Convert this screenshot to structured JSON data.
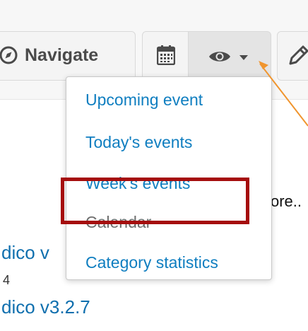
{
  "toolbar": {
    "navigate_label": "Navigate",
    "navigate_icon": "compass-icon",
    "calendar_icon": "calendar-icon",
    "view_icon": "eye-icon",
    "view_caret_icon": "caret-down-icon",
    "edit_icon": "pencil-icon"
  },
  "dropdown": {
    "items": [
      {
        "label": "Upcoming event",
        "enabled": true
      },
      {
        "label": "Today's events",
        "enabled": true
      },
      {
        "label": "Week's events",
        "enabled": true
      },
      {
        "label": "Calendar",
        "enabled": false
      },
      {
        "label": "Category statistics",
        "enabled": true
      }
    ]
  },
  "background": {
    "more_text": "ore..",
    "event1_title": "dico v",
    "event1_sub": "4",
    "event2_title": "dico v3.2.7"
  },
  "colors": {
    "link": "#0f7ec0",
    "disabled": "#6e6e6e",
    "highlight": "#a50d0d",
    "arrow": "#f0952e"
  }
}
